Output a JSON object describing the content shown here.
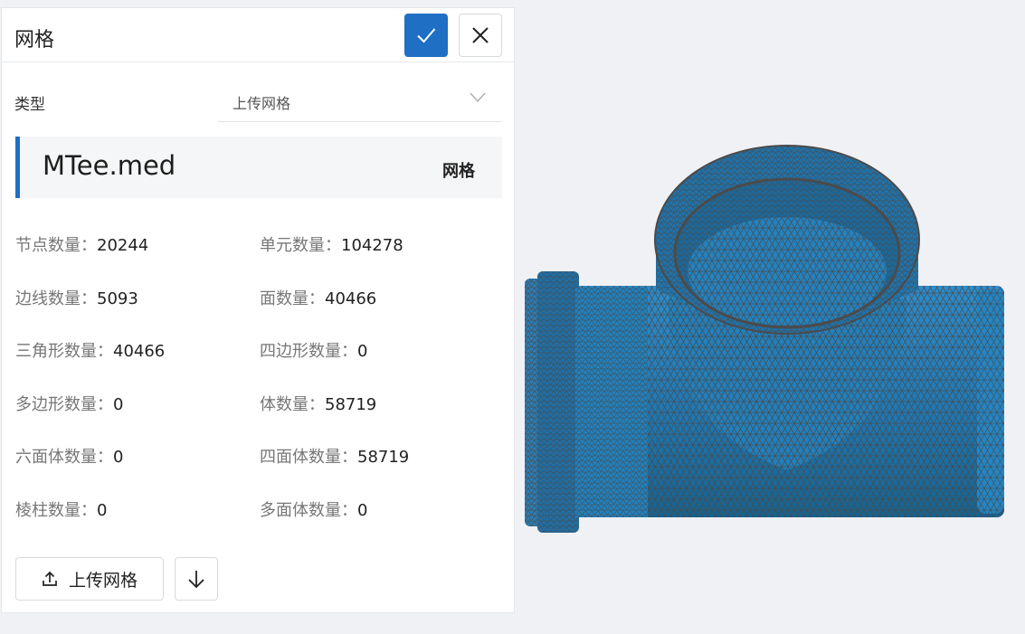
{
  "panel": {
    "title": "网格",
    "confirm_icon": "check-icon",
    "close_icon": "close-icon"
  },
  "type_field": {
    "label": "类型",
    "value": "上传网格"
  },
  "file": {
    "name": "MTee.med",
    "kind": "网格"
  },
  "stats": [
    {
      "label": "节点数量：",
      "value": "20244"
    },
    {
      "label": "单元数量：",
      "value": "104278"
    },
    {
      "label": "边线数量：",
      "value": "5093"
    },
    {
      "label": "面数量：",
      "value": "40466"
    },
    {
      "label": "三角形数量：",
      "value": "40466"
    },
    {
      "label": "四边形数量：",
      "value": "0"
    },
    {
      "label": "多边形数量：",
      "value": "0"
    },
    {
      "label": "体数量：",
      "value": "58719"
    },
    {
      "label": "六面体数量：",
      "value": "0"
    },
    {
      "label": "四面体数量：",
      "value": "58719"
    },
    {
      "label": "棱柱数量：",
      "value": "0"
    },
    {
      "label": "多面体数量：",
      "value": "0"
    }
  ],
  "actions": {
    "upload_label": "上传网格",
    "upload_icon": "upload-icon",
    "download_icon": "download-icon"
  },
  "colors": {
    "accent": "#1f6fc4",
    "mesh_fill": "#1e7ab8",
    "mesh_edge": "#555555",
    "background": "#f0f1f4"
  }
}
